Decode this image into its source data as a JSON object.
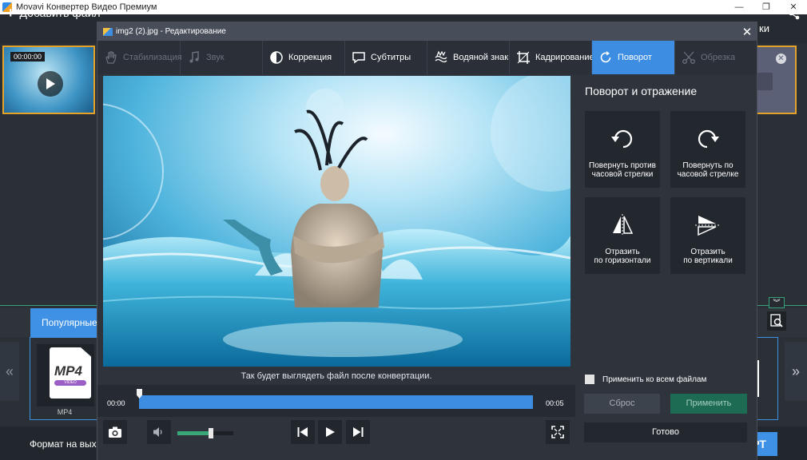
{
  "app": {
    "title": "Movavi Конвертер Видео Премиум",
    "window_controls": [
      "—",
      "❐",
      "✕"
    ]
  },
  "main_toolbar": {
    "add_files_label": "Добавить файл",
    "right_fragment": "ки"
  },
  "file_list": {
    "timecode": "00:00:00"
  },
  "formats": {
    "active_tab": "Популярные",
    "collapse_glyph": "︾",
    "left_arrow": "«",
    "right_arrow": "»",
    "card_label": "MP4",
    "card_badge": "VIDEO",
    "card_caption": "MP4"
  },
  "bottom": {
    "output_format_label": "Формат на выхо",
    "convert_fragment": "РТ"
  },
  "dialog": {
    "title": "img2 (2).jpg - Редактирование",
    "close_glyph": "✕",
    "tools": [
      {
        "label": "Стабилизация",
        "state": "disabled"
      },
      {
        "label": "Звук",
        "state": "disabled"
      },
      {
        "label": "Коррекция",
        "state": "normal"
      },
      {
        "label": "Субтитры",
        "state": "normal"
      },
      {
        "label": "Водяной знак",
        "state": "normal"
      },
      {
        "label": "Кадрирование",
        "state": "normal"
      },
      {
        "label": "Поворот",
        "state": "active"
      },
      {
        "label": "Обрезка",
        "state": "disabled"
      }
    ],
    "preview_caption": "Так будет выглядеть файл после конвертации.",
    "timeline": {
      "start": "00:00",
      "end": "00:05",
      "position": 0
    },
    "volume_level": 0.6,
    "side": {
      "title": "Поворот и отражение",
      "rotate_ccw": [
        "Повернуть против",
        "часовой стрелки"
      ],
      "rotate_cw": [
        "Повернуть по",
        "часовой стрелке"
      ],
      "flip_horizontal": [
        "Отразить",
        "по горизонтали"
      ],
      "flip_vertical": [
        "Отразить",
        "по вертикали"
      ],
      "apply_all_label": "Применить ко всем файлам",
      "apply_all_checked": false,
      "reset_label": "Сброс",
      "apply_label": "Применить",
      "done_label": "Готово"
    },
    "colors": {
      "accent": "#3d8ee2",
      "green": "#1d6b52",
      "highlight": "#e5a22b"
    }
  }
}
